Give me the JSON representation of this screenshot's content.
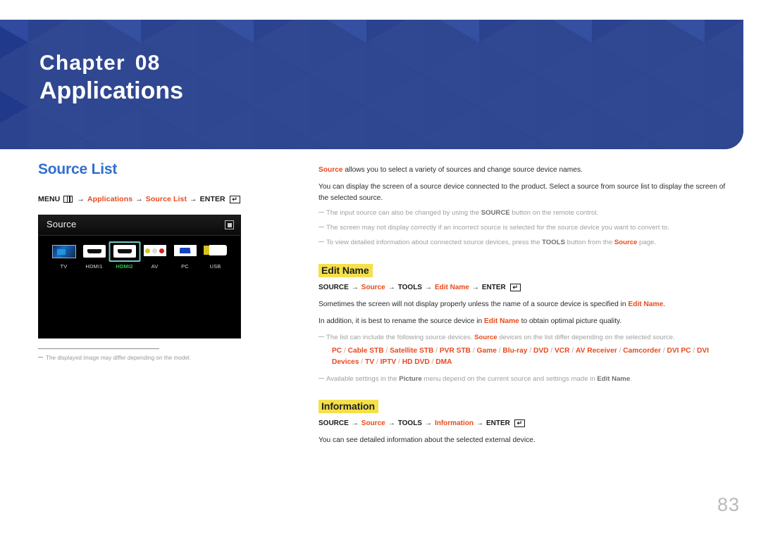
{
  "banner": {
    "chapter_label": "Chapter",
    "chapter_number": "08",
    "chapter_title": "Applications",
    "bg_color": "#24409a"
  },
  "left": {
    "section_title": "Source List",
    "menu_path": {
      "start": "MENU",
      "menu_icon": "menu-grid-icon",
      "arrow": "→",
      "items": [
        "Applications",
        "Source List"
      ],
      "end": "ENTER",
      "enter_icon": "enter-key-icon"
    },
    "tv_screenshot": {
      "title": "Source",
      "return_icon": "return-icon",
      "sources": [
        {
          "label": "TV",
          "icon": "tv-icon",
          "selected": false
        },
        {
          "label": "HDMI1",
          "icon": "hdmi-port-icon",
          "selected": false
        },
        {
          "label": "HDMI2",
          "icon": "hdmi-port-icon",
          "selected": true
        },
        {
          "label": "AV",
          "icon": "av-rca-icon",
          "selected": false
        },
        {
          "label": "PC",
          "icon": "vga-port-icon",
          "selected": false
        },
        {
          "label": "USB",
          "icon": "usb-icon",
          "selected": false
        }
      ]
    },
    "footnote": "The displayed image may differ depending on the model."
  },
  "right": {
    "intro_1_accent": "Source",
    "intro_1_rest": " allows you to select a variety of sources and change source device names.",
    "intro_2": "You can display the screen of a source device connected to the product. Select a source from source list to display the screen of the selected source.",
    "notes_top": [
      {
        "pre": "The input source can also be changed by using the ",
        "bold": "SOURCE",
        "post": " button on the remote control."
      },
      {
        "pre": "The screen may not display correctly if an incorrect source is selected for the source device you want to convert to.",
        "bold": "",
        "post": ""
      },
      {
        "pre": "To view detailed information about connected source devices, press the ",
        "bold": "TOOLS",
        "post": " button from the ",
        "accent": "Source",
        "tail": " page."
      }
    ],
    "edit_name": {
      "heading": "Edit Name",
      "path": {
        "start": "SOURCE",
        "arrow": "→",
        "item1": "Source",
        "mid": "TOOLS",
        "item2": "Edit Name",
        "end": "ENTER",
        "enter_icon": "enter-key-icon"
      },
      "para_1_pre": "Sometimes the screen will not display properly unless the name of a source device is specified in ",
      "para_1_accent": "Edit Name",
      "para_1_post": ".",
      "para_2_pre": "In addition, it is best to rename the source device in ",
      "para_2_accent": "Edit Name",
      "para_2_post": " to obtain optimal picture quality.",
      "note_list_pre": "The list can include the following source devices. ",
      "note_list_accent": "Source",
      "note_list_post": " devices on the list differ depending on the selected source.",
      "devices": [
        "PC",
        "Cable STB",
        "Satellite STB",
        "PVR STB",
        "Game",
        "Blu-ray",
        "DVD",
        "VCR",
        "AV Receiver",
        "Camcorder",
        "DVI PC",
        "DVI Devices",
        "TV",
        "IPTV",
        "HD DVD",
        "DMA"
      ],
      "note_picture_pre": "Available settings in the ",
      "note_picture_b1": "Picture",
      "note_picture_mid": " menu depend on the current source and settings made in ",
      "note_picture_b2": "Edit Name",
      "note_picture_post": "."
    },
    "information": {
      "heading": "Information",
      "path": {
        "start": "SOURCE",
        "arrow": "→",
        "item1": "Source",
        "mid": "TOOLS",
        "item2": "Information",
        "end": "ENTER",
        "enter_icon": "enter-key-icon"
      },
      "para": "You can see detailed information about the selected external device."
    }
  },
  "page_number": "83",
  "colors": {
    "accent_orange": "#e8491d",
    "title_blue": "#2f6fd0",
    "highlight_yellow": "#f5e04a",
    "banner_blue": "#24409a",
    "selected_green": "#27c93f"
  }
}
